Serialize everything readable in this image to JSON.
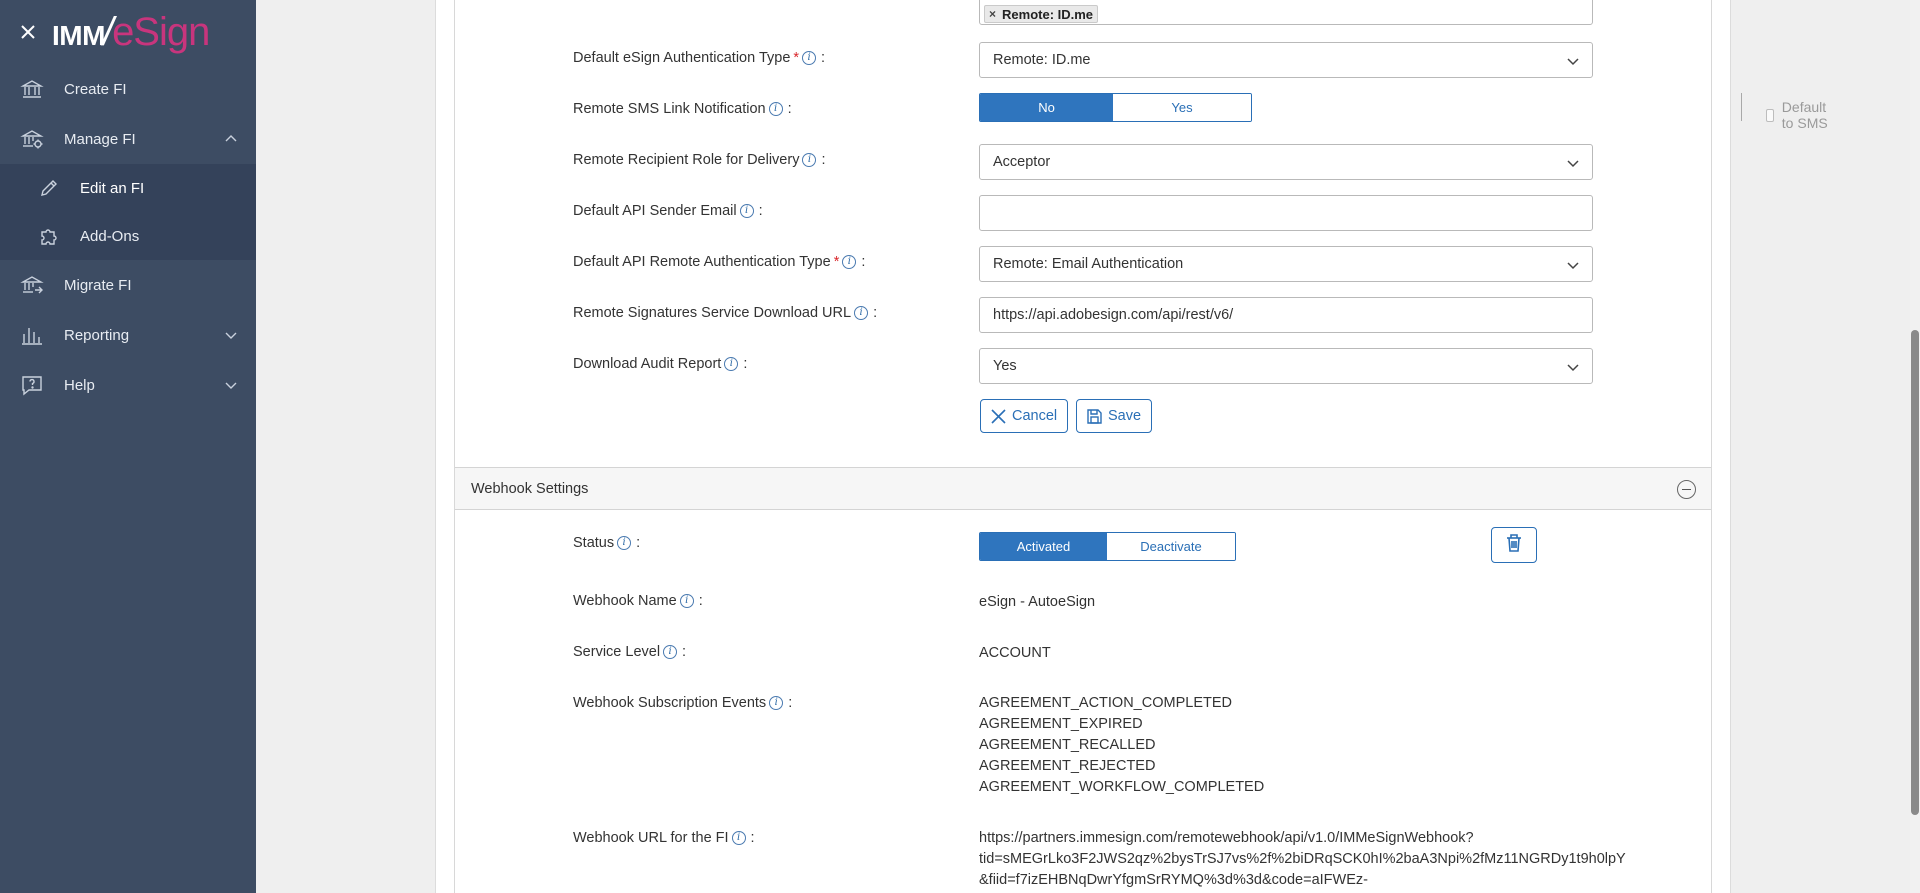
{
  "sidebar": {
    "logo_left": "IMM",
    "logo_right": "eSign",
    "items": [
      {
        "label": "Create FI",
        "icon": "bank-icon"
      },
      {
        "label": "Manage FI",
        "icon": "bank-settings-icon",
        "expanded": true
      },
      {
        "label": "Edit an FI",
        "icon": "pencil-icon"
      },
      {
        "label": "Add-Ons",
        "icon": "puzzle-icon"
      },
      {
        "label": "Migrate FI",
        "icon": "bank-migrate-icon"
      },
      {
        "label": "Reporting",
        "icon": "bar-chart-icon"
      },
      {
        "label": "Help",
        "icon": "help-chat-icon"
      }
    ]
  },
  "form": {
    "auth_types_tag": "Remote: ID.me",
    "auth_types_tag_remove": "×",
    "default_auth_label": "Default eSign Authentication Type",
    "default_auth_value": "Remote: ID.me",
    "sms_label": "Remote SMS Link Notification",
    "sms_no": "No",
    "sms_yes": "Yes",
    "default_to_sms": "Default to SMS",
    "recipient_role_label": "Remote Recipient Role for Delivery",
    "recipient_role_value": "Acceptor",
    "api_sender_label": "Default API Sender Email",
    "api_sender_value": "",
    "api_auth_label": "Default API Remote Authentication Type",
    "api_auth_value": "Remote: Email Authentication",
    "download_url_label": "Remote Signatures Service Download URL",
    "download_url_value": "https://api.adobesign.com/api/rest/v6/",
    "audit_label": "Download Audit Report",
    "audit_value": "Yes",
    "required_mark": "*",
    "info_mark": "i",
    "colon": ":",
    "cancel_label": "Cancel",
    "save_label": "Save"
  },
  "webhook": {
    "section_title": "Webhook Settings",
    "status_label": "Status",
    "activated": "Activated",
    "deactivate": "Deactivate",
    "name_label": "Webhook Name",
    "name_value": "eSign - AutoeSign",
    "service_level_label": "Service Level",
    "service_level_value": "ACCOUNT",
    "events_label": "Webhook Subscription Events",
    "events": [
      "AGREEMENT_ACTION_COMPLETED",
      "AGREEMENT_EXPIRED",
      "AGREEMENT_RECALLED",
      "AGREEMENT_REJECTED",
      "AGREEMENT_WORKFLOW_COMPLETED"
    ],
    "url_label": "Webhook URL for the FI",
    "url_lines": [
      "https://partners.immesign.com/remotewebhook/api/v1.0/IMMeSignWebhook?",
      "tid=sMEGrLko3F2JWS2qz%2bysTrSJ7vs%2f%2biDRqSCK0hI%2baA3Npi%2fMz11NGRDy1t9h0lpY",
      "&fiid=f7izEHBNqDwrYfgmSrRYMQ%3d%3d&code=aIFWEz-"
    ]
  },
  "colors": {
    "sidebar_bg": "#3d4c63",
    "accent_blue": "#2f75be",
    "logo_pink": "#c8357d",
    "required_red": "#d9262b"
  }
}
